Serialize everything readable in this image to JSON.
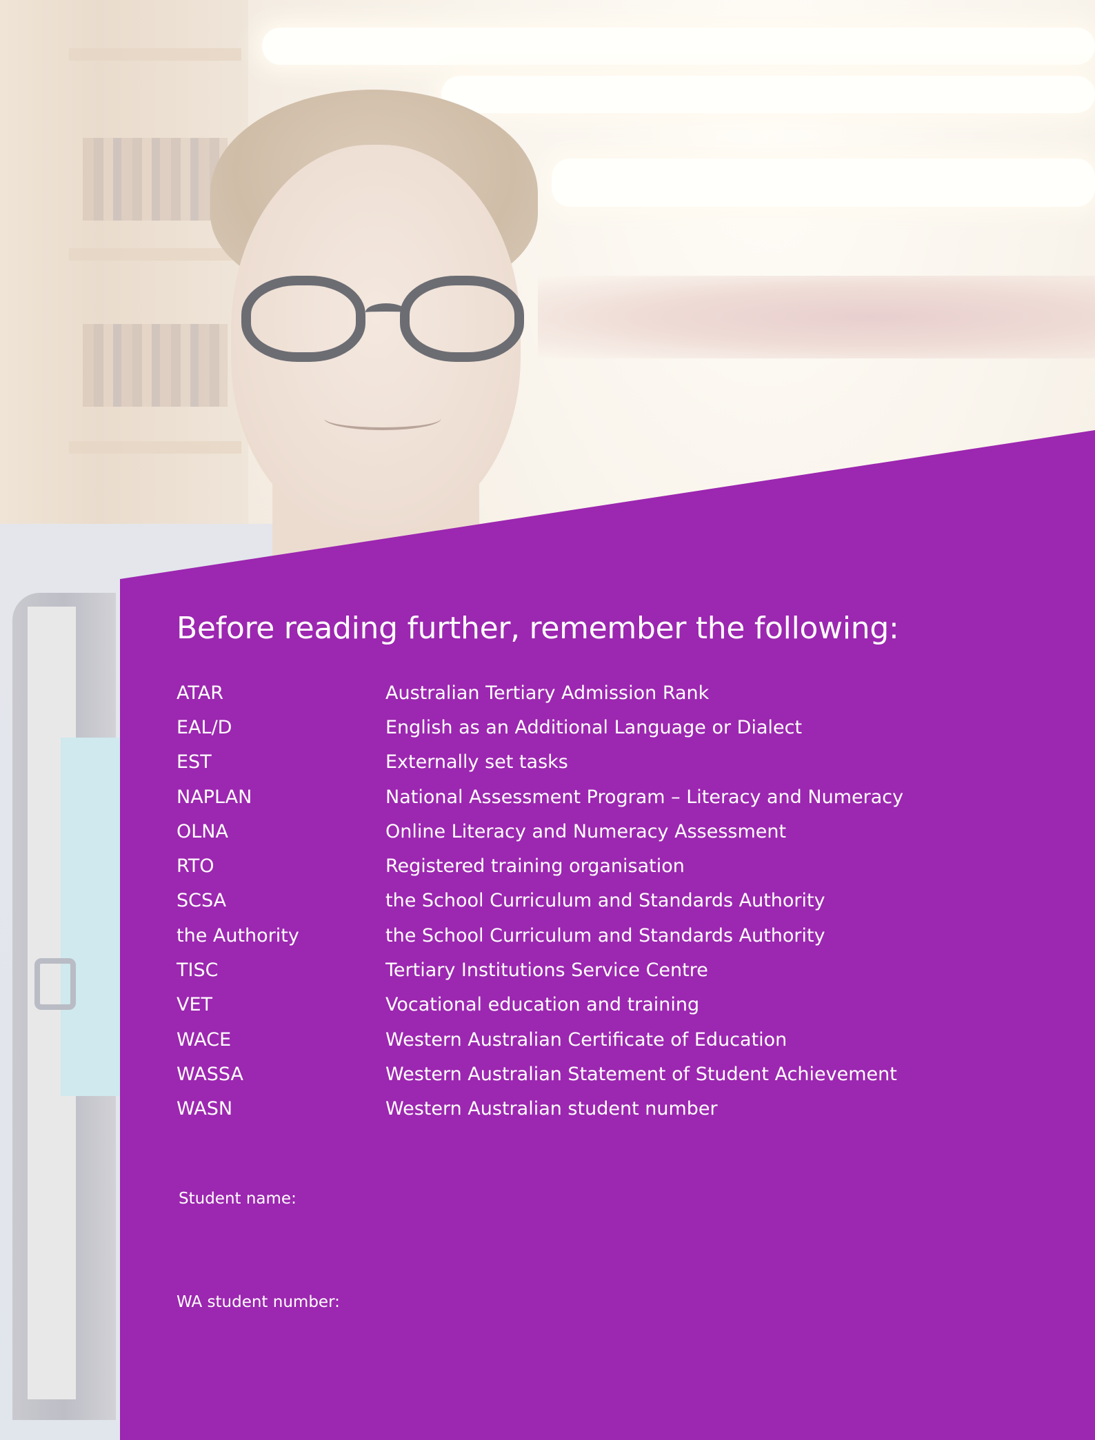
{
  "colors": {
    "panel_purple": "#9c27b0",
    "text": "#ffffff"
  },
  "heading": "Before reading further, remember the following:",
  "abbreviations": [
    {
      "term": "ATAR",
      "definition": "Australian Tertiary Admission Rank"
    },
    {
      "term": "EAL/D",
      "definition": "English as an Additional Language or Dialect"
    },
    {
      "term": "EST",
      "definition": "Externally set tasks"
    },
    {
      "term": "NAPLAN",
      "definition": "National Assessment Program – Literacy and Numeracy"
    },
    {
      "term": "OLNA",
      "definition": "Online Literacy and Numeracy Assessment"
    },
    {
      "term": "RTO",
      "definition": "Registered training organisation"
    },
    {
      "term": "SCSA",
      "definition": "the School Curriculum and Standards Authority"
    },
    {
      "term": "the Authority",
      "definition": "the School Curriculum and Standards Authority"
    },
    {
      "term": "TISC",
      "definition": "Tertiary Institutions Service Centre"
    },
    {
      "term": "VET",
      "definition": "Vocational education and training"
    },
    {
      "term": "WACE",
      "definition": "Western Australian Certificate of Education"
    },
    {
      "term": "WASSA",
      "definition": "Western Australian Statement of Student Achievement"
    },
    {
      "term": "WASN",
      "definition": "Western Australian student number"
    }
  ],
  "form": {
    "student_name_label": "Student name:",
    "student_number_label": "WA student number:"
  }
}
